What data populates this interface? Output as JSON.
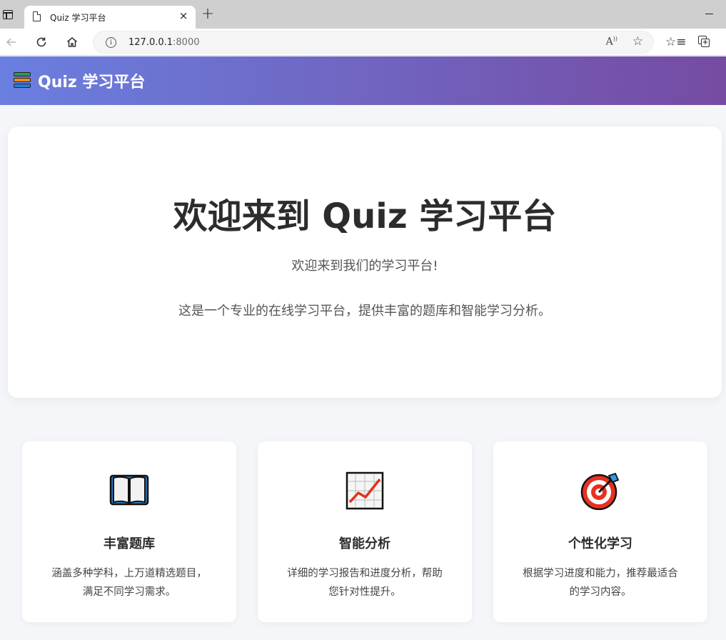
{
  "browser": {
    "tab_title": "Quiz 学习平台",
    "tab_close": "×",
    "new_tab": "+",
    "url_host": "127.0.0.1",
    "url_port": ":8000",
    "read_aloud": "A⁾",
    "icons": [
      "window-menu-icon",
      "page-icon",
      "back-icon",
      "reload-icon",
      "home-icon",
      "info-icon",
      "read-aloud-icon",
      "add-favorite-icon",
      "favorites-icon",
      "collections-icon"
    ]
  },
  "header": {
    "title": "Quiz 学习平台",
    "icon": "books-icon",
    "gradient": [
      "#667eea",
      "#764ba2"
    ]
  },
  "hero": {
    "title": "欢迎来到 Quiz 学习平台",
    "text1": "欢迎来到我们的学习平台!",
    "text2": "这是一个专业的在线学习平台，提供丰富的题库和智能学习分析。"
  },
  "features": [
    {
      "icon": "open-book-icon",
      "title": "丰富题库",
      "desc_line1": "涵盖多种学科，上万道精选题目，",
      "desc_line2": "满足不同学习需求。"
    },
    {
      "icon": "chart-increasing-icon",
      "title": "智能分析",
      "desc_line1": "详细的学习报告和进度分析，帮助",
      "desc_line2": "您针对性提升。"
    },
    {
      "icon": "target-icon",
      "title": "个性化学习",
      "desc_line1": "根据学习进度和能力，推荐最适合",
      "desc_line2": "的学习内容。"
    }
  ]
}
